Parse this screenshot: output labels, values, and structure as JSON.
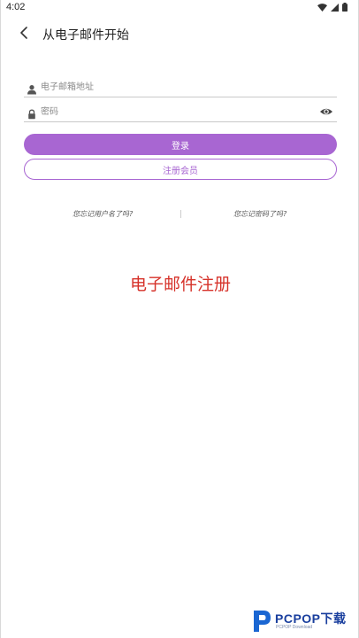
{
  "status_bar": {
    "time": "4:02",
    "icons": [
      "wifi-icon",
      "signal-icon",
      "battery-icon"
    ]
  },
  "header": {
    "back_icon": "chevron-left-icon",
    "title": "从电子邮件开始"
  },
  "form": {
    "email": {
      "icon": "user-icon",
      "placeholder": "电子邮箱地址",
      "value": ""
    },
    "password": {
      "icon": "lock-icon",
      "placeholder": "密码",
      "value": "",
      "toggle_icon": "eye-icon"
    },
    "login_label": "登录",
    "register_label": "注册会员",
    "forgot_username": "您忘记用户名了吗?",
    "forgot_password": "您忘记密码了吗?"
  },
  "annotation": {
    "caption": "电子邮件注册"
  },
  "watermark": {
    "brand": "PCPOP下载",
    "sub": "PCPOP Download"
  },
  "colors": {
    "accent": "#a866d2",
    "caption_red": "#d6322a",
    "watermark_blue": "#1a3f9e"
  }
}
